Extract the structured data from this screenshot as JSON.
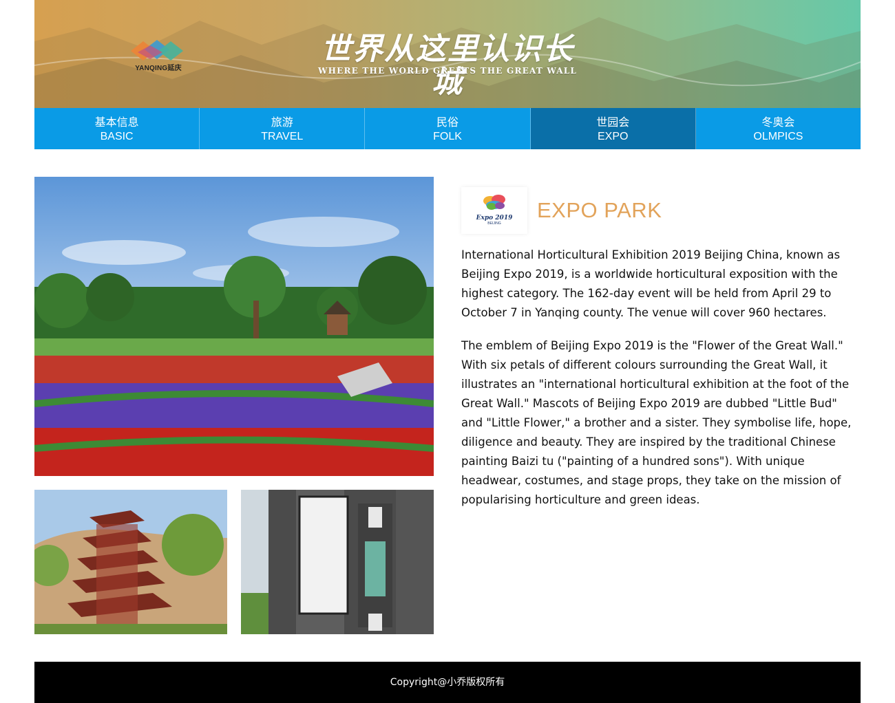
{
  "header": {
    "logo_text": "YANQING延庆",
    "title_cn": "世界从这里认识长城",
    "subtitle_en": "WHERE THE WORLD GREETS THE GREAT WALL"
  },
  "nav": {
    "items": [
      {
        "cn": "基本信息",
        "en": "BASIC",
        "active": false
      },
      {
        "cn": "旅游",
        "en": "TRAVEL",
        "active": false
      },
      {
        "cn": "民俗",
        "en": "FOLK",
        "active": false
      },
      {
        "cn": "世园会",
        "en": "EXPO",
        "active": true
      },
      {
        "cn": "冬奥会",
        "en": "OLMPICS",
        "active": false
      }
    ]
  },
  "content": {
    "logo_text": "Expo 2019",
    "logo_sub": "BEIJING",
    "title": "EXPO PARK",
    "paragraphs": [
      "International Horticultural Exhibition 2019 Beijing China, known as Beijing Expo 2019, is a worldwide horticultural exposition with the highest category. The 162-day event will be held from April 29 to October 7 in Yanqing county. The venue will cover 960 hectares.",
      "The emblem of Beijing Expo 2019 is the \"Flower of the Great Wall.\" With six petals of different colours surrounding the Great Wall, it illustrates an \"international horticultural exhibition at the foot of the Great Wall.\" Mascots of Beijing Expo 2019 are dubbed \"Little Bud\" and \"Little Flower,\" a brother and a sister. They symbolise life, hope, diligence and beauty. They are inspired by the traditional Chinese painting Baizi tu (\"painting of a hundred sons\"). With unique headwear, costumes, and stage props, they take on the mission of popularising horticulture and green ideas."
    ]
  },
  "footer": {
    "copyright": "Copyright@小乔版权所有"
  },
  "colors": {
    "nav_bg": "#0a9be6",
    "nav_active": "#0a6fa8",
    "title_accent": "#e2a35a",
    "footer_bg": "#000000"
  }
}
